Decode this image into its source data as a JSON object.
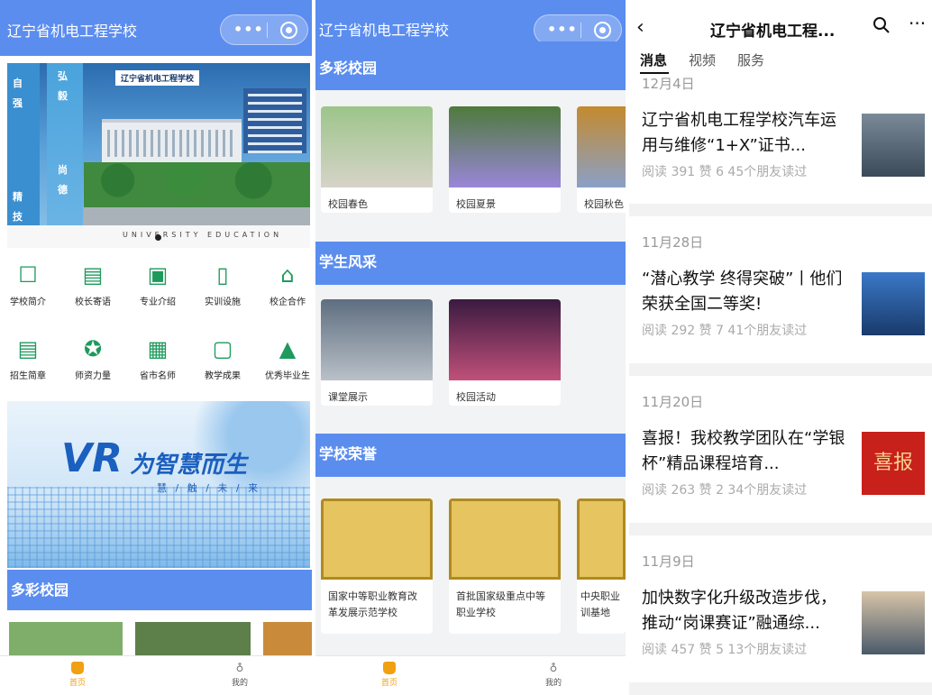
{
  "panel1": {
    "title": "辽宁省机电工程学校",
    "menu_dots": "•••",
    "banner": {
      "school_name": "辽宁省机电工程学校",
      "side_chars_left": [
        "自",
        "强"
      ],
      "side_chars_left2": [
        "精",
        "技"
      ],
      "side_chars_right": [
        "弘",
        "毅"
      ],
      "side_chars_right2": [
        "尚",
        "德"
      ],
      "footer_text": "UNIVERSITY EDUCATION"
    },
    "grid": [
      {
        "label": "学校简介",
        "icon": "school-intro-icon",
        "glyph": "☐"
      },
      {
        "label": "校长寄语",
        "icon": "message-icon",
        "glyph": "▤"
      },
      {
        "label": "专业介绍",
        "icon": "chart-icon",
        "glyph": "▣"
      },
      {
        "label": "实训设施",
        "icon": "document-icon",
        "glyph": "▯"
      },
      {
        "label": "校企合作",
        "icon": "building-icon",
        "glyph": "⌂"
      },
      {
        "label": "招生简章",
        "icon": "list-icon",
        "glyph": "▤"
      },
      {
        "label": "师资力量",
        "icon": "medal-icon",
        "glyph": "✪"
      },
      {
        "label": "省市名师",
        "icon": "card-icon",
        "glyph": "▦"
      },
      {
        "label": "教学成果",
        "icon": "result-icon",
        "glyph": "▢"
      },
      {
        "label": "优秀毕业生",
        "icon": "graduation-cap-icon",
        "glyph": "▲"
      }
    ],
    "vr_banner": {
      "big": "VR",
      "sub": "为智慧而生",
      "tag": "慧 / 触 / 未 / 来"
    },
    "section": "多彩校园"
  },
  "panel2": {
    "title": "辽宁省机电工程学校",
    "menu_dots": "•••",
    "sections": [
      {
        "title": "多彩校园",
        "cards": [
          "校园春色",
          "校园夏景",
          "校园秋色"
        ]
      },
      {
        "title": "学生风采",
        "cards": [
          "课堂展示",
          "校园活动"
        ]
      },
      {
        "title": "学校荣誉",
        "cards": [
          "国家中等职业教育改革发展示范学校",
          "首批国家级重点中等职业学校",
          "中央职业训基地"
        ]
      }
    ]
  },
  "tabbar": {
    "home": "首页",
    "mine": "我的"
  },
  "panel3": {
    "back": "‹",
    "title": "辽宁省机电工程...",
    "more": "···",
    "tabs": [
      "消息",
      "视频",
      "服务"
    ],
    "articles": [
      {
        "date": "12月4日",
        "title": "辽宁省机电工程学校汽车运用与维修“1+X”证书...",
        "stats": "阅读 391  赞 6  45个朋友读过"
      },
      {
        "date": "11月28日",
        "title": "“潜心教学 终得突破”丨他们荣获全国二等奖!",
        "stats": "阅读 292  赞 7  41个朋友读过"
      },
      {
        "date": "11月20日",
        "title": "喜报！我校教学团队在“学银杯”精品课程培育...",
        "stats": "阅读 263  赞 2  34个朋友读过"
      },
      {
        "date": "11月9日",
        "title": "加快数字化升级改造步伐，推动“岗课赛证”融通综...",
        "stats": "阅读 457  赞 5  13个朋友读过"
      }
    ],
    "thumb_texts": [
      "",
      "",
      "喜报",
      ""
    ]
  }
}
